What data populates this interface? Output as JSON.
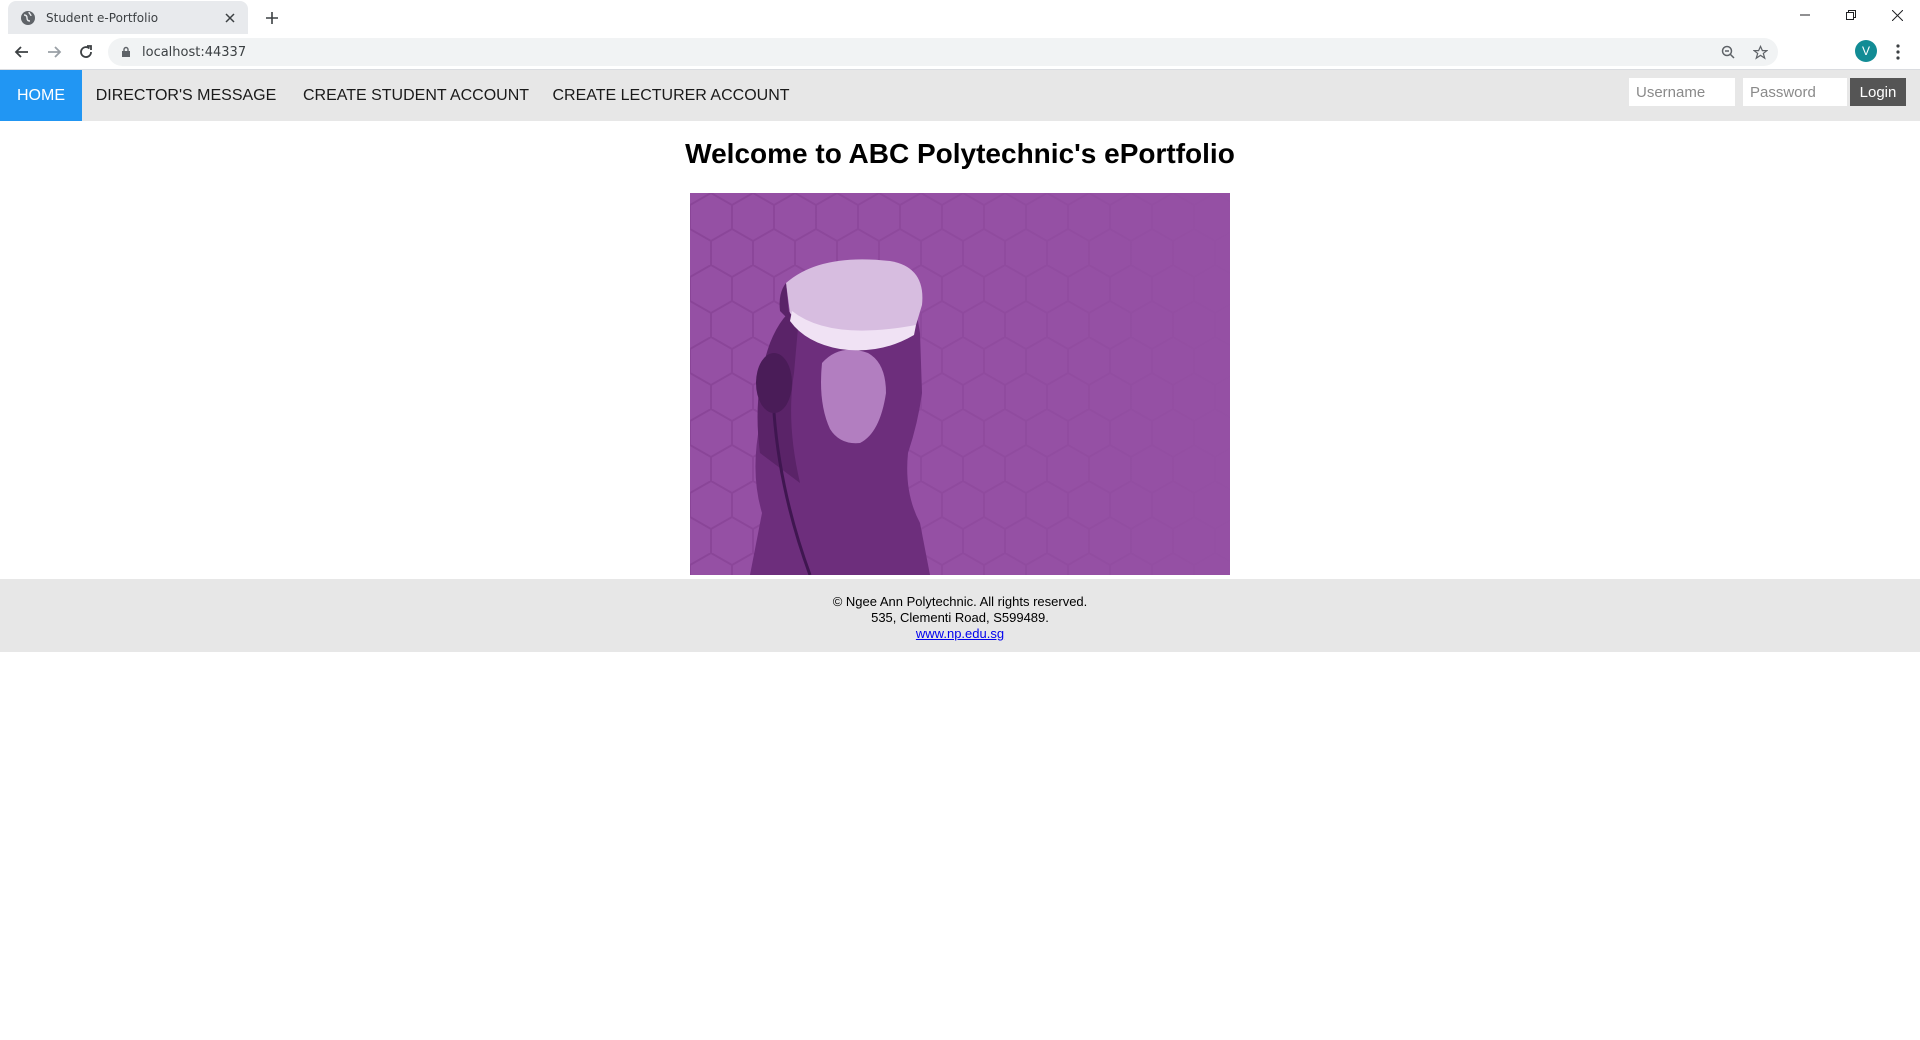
{
  "browser": {
    "tab_title": "Student e-Portfolio",
    "url": "localhost:44337",
    "profile_initial": "V"
  },
  "navbar": {
    "items": [
      {
        "label": "HOME",
        "active": true
      },
      {
        "label": "DIRECTOR'S MESSAGE",
        "active": false
      },
      {
        "label": "CREATE STUDENT ACCOUNT",
        "active": false
      },
      {
        "label": "CREATE LECTURER ACCOUNT",
        "active": false
      }
    ],
    "username_placeholder": "Username",
    "password_placeholder": "Password",
    "login_label": "Login"
  },
  "main": {
    "title": "Welcome to ABC Polytechnic's ePortfolio",
    "hero_image": "vr-headset-person-purple-hexagon"
  },
  "footer": {
    "copyright": "© Ngee Ann Polytechnic. All rights reserved.",
    "address": "535, Clementi Road, S599489.",
    "link": "www.np.edu.sg"
  },
  "colors": {
    "nav_active": "#2196f3",
    "nav_bg": "#e7e7e7",
    "hero_purple": "#9550a4",
    "login_button": "#555555"
  }
}
